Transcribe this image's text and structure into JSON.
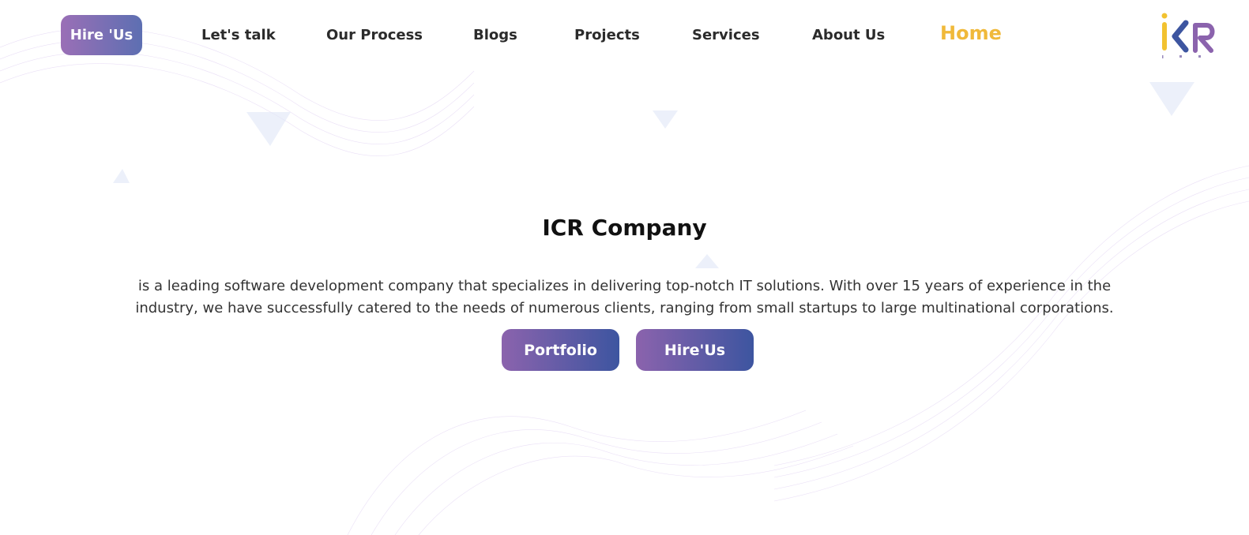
{
  "nav": {
    "hire_label": "Hire 'Us",
    "items": [
      {
        "label": "Let's talk"
      },
      {
        "label": "Our Process"
      },
      {
        "label": "Blogs"
      },
      {
        "label": "Projects"
      },
      {
        "label": "Services"
      },
      {
        "label": "About Us"
      },
      {
        "label": "Home",
        "active": true
      }
    ]
  },
  "logo": {
    "text": "ICR",
    "icon": "icr-logo-icon"
  },
  "hero": {
    "title": "ICR Company",
    "description": "is a leading software development company that specializes in delivering top-notch IT solutions. With over 15 years of experience in the industry, we have successfully catered to the needs of numerous clients, ranging from small startups to large multinational corporations.",
    "portfolio_label": "Portfolio",
    "hire_label": "Hire'Us"
  },
  "colors": {
    "accent_purple": "#8b63ad",
    "accent_blue": "#3d55a0",
    "home_active": "#f0b93a",
    "logo_yellow": "#f2c230"
  }
}
